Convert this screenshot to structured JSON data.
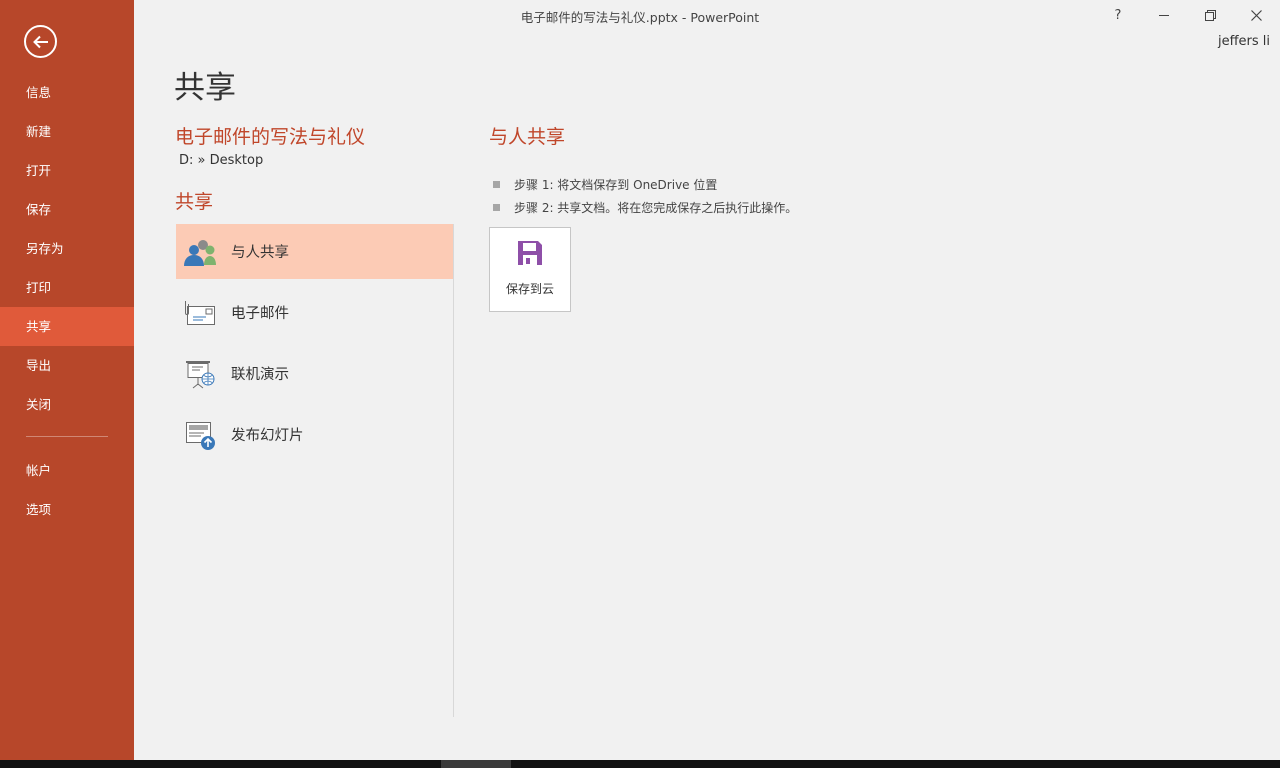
{
  "window": {
    "title": "电子邮件的写法与礼仪.pptx - PowerPoint",
    "help": "?",
    "user": "jeffers li"
  },
  "sidebar": {
    "items": [
      {
        "label": "信息"
      },
      {
        "label": "新建"
      },
      {
        "label": "打开"
      },
      {
        "label": "保存"
      },
      {
        "label": "另存为"
      },
      {
        "label": "打印"
      },
      {
        "label": "共享",
        "active": true
      },
      {
        "label": "导出"
      },
      {
        "label": "关闭"
      }
    ],
    "bottom_items": [
      {
        "label": "帐户"
      },
      {
        "label": "选项"
      }
    ]
  },
  "main": {
    "page_title": "共享",
    "doc_title": "电子邮件的写法与礼仪",
    "doc_path": "D: » Desktop",
    "section_title": "共享",
    "share_options": [
      {
        "label": "与人共享",
        "icon": "people-icon",
        "active": true
      },
      {
        "label": "电子邮件",
        "icon": "email-icon"
      },
      {
        "label": "联机演示",
        "icon": "present-online-icon"
      },
      {
        "label": "发布幻灯片",
        "icon": "publish-slides-icon"
      }
    ]
  },
  "detail": {
    "title": "与人共享",
    "steps": [
      "步骤 1: 将文档保存到 OneDrive 位置",
      "步骤 2: 共享文档。将在您完成保存之后执行此操作。"
    ],
    "save_button_label": "保存到云"
  },
  "colors": {
    "sidebar": "#b7472a",
    "sidebar_active": "#e05a3a",
    "accent_text": "#c0462a",
    "selected_option": "#fccbb5"
  }
}
